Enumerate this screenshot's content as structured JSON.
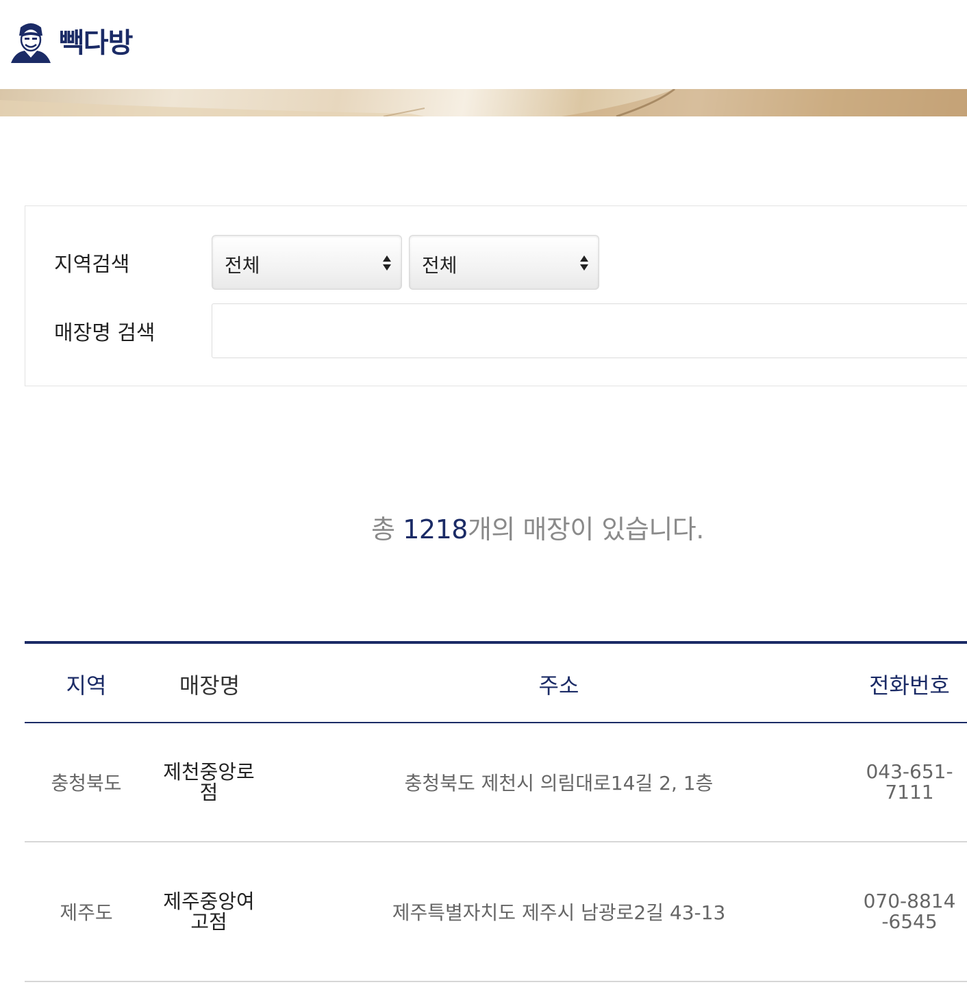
{
  "header": {
    "brand_name": "빽다방",
    "logo_icon": "chef-face-logo"
  },
  "search": {
    "region_label": "지역검색",
    "region_select_1": "전체",
    "region_select_2": "전체",
    "store_label": "매장명 검색",
    "store_input_value": "",
    "store_input_placeholder": ""
  },
  "summary": {
    "prefix": "총 ",
    "count": "1218",
    "suffix": "개의 매장이 있습니다."
  },
  "table": {
    "headers": {
      "region": "지역",
      "name": "매장명",
      "address": "주소",
      "phone": "전화번호"
    },
    "rows": [
      {
        "region": "충청북도",
        "name": "제천중앙로점",
        "address": "충청북도 제천시 의림대로14길 2, 1층",
        "phone": "043-651-7111"
      },
      {
        "region": "제주도",
        "name": "제주중앙여고점",
        "address": "제주특별자치도 제주시 남광로2길 43-13",
        "phone": "070-8814-6545"
      }
    ]
  },
  "colors": {
    "brand_navy": "#1b2b66",
    "muted_text": "#8a8a8a",
    "divider": "#d6d6d6"
  }
}
